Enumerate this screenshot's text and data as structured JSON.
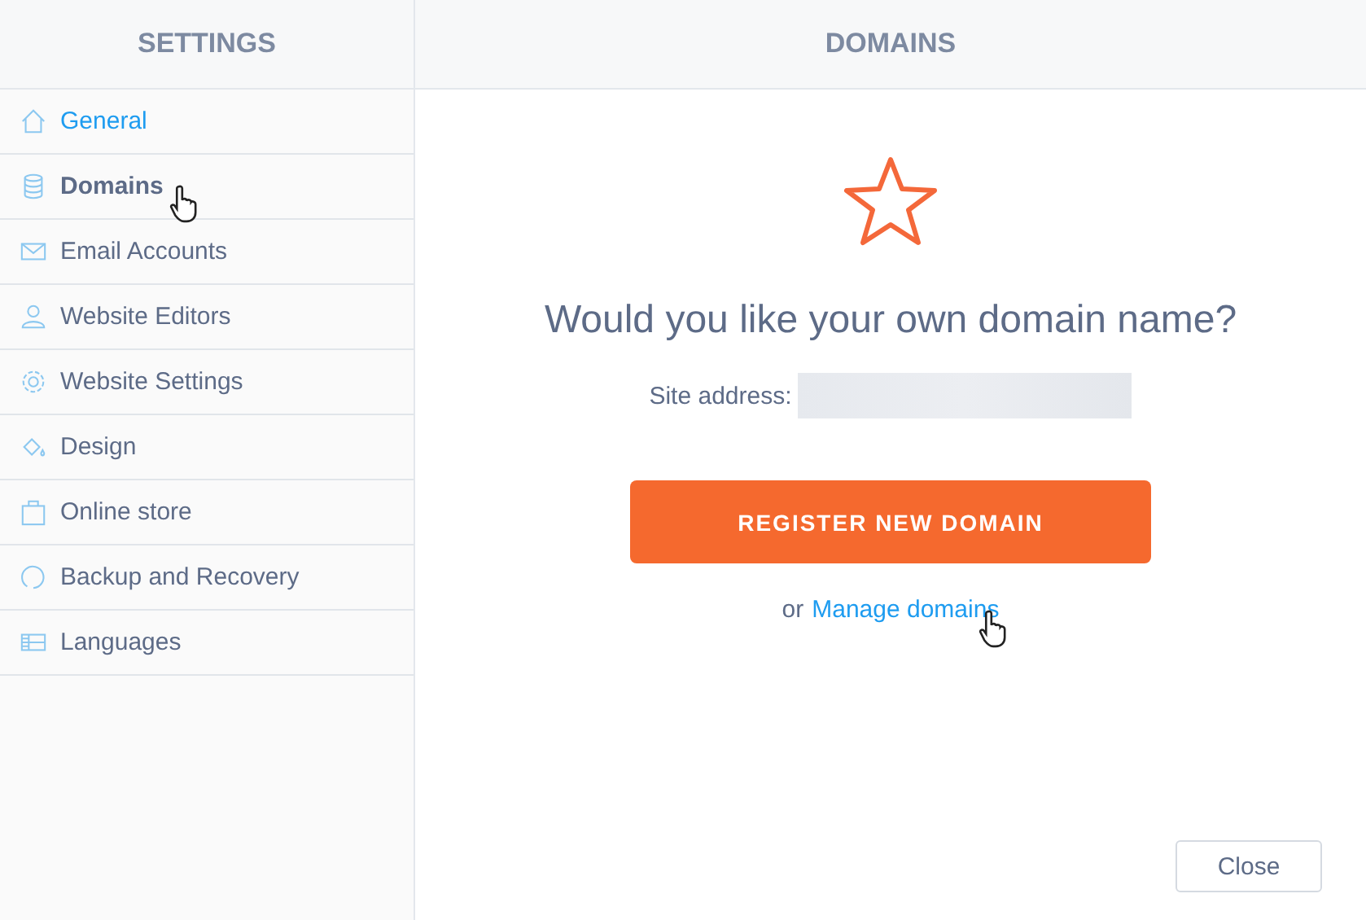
{
  "sidebar": {
    "title": "SETTINGS",
    "items": [
      {
        "label": "General",
        "selected": false,
        "highlighted": true
      },
      {
        "label": "Domains",
        "selected": true,
        "highlighted": false
      },
      {
        "label": "Email Accounts",
        "selected": false,
        "highlighted": false
      },
      {
        "label": "Website Editors",
        "selected": false,
        "highlighted": false
      },
      {
        "label": "Website Settings",
        "selected": false,
        "highlighted": false
      },
      {
        "label": "Design",
        "selected": false,
        "highlighted": false
      },
      {
        "label": "Online store",
        "selected": false,
        "highlighted": false
      },
      {
        "label": "Backup and Recovery",
        "selected": false,
        "highlighted": false
      },
      {
        "label": "Languages",
        "selected": false,
        "highlighted": false
      }
    ]
  },
  "main": {
    "title": "DOMAINS",
    "heading": "Would you like your own domain name?",
    "site_address_label": "Site address:",
    "register_button": "REGISTER NEW DOMAIN",
    "or_text": "or",
    "manage_link": "Manage domains",
    "close_button": "Close"
  }
}
